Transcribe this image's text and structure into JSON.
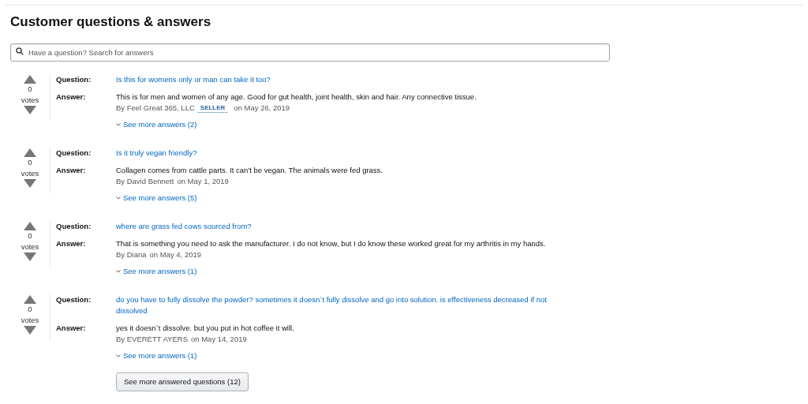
{
  "title": "Customer questions & answers",
  "search": {
    "placeholder": "Have a question? Search for answers"
  },
  "items": [
    {
      "votes": "0",
      "votes_label": "votes",
      "question_label": "Question:",
      "answer_label": "Answer:",
      "question": "Is this for womens only or man can take it too?",
      "answer": "This is for men and women of any age. Good for gut health, joint health, skin and hair. Any connective tissue.",
      "author": "By Feel Great 365, LLC",
      "badge": "SELLER",
      "date": "on May 26, 2019",
      "more": "See more answers (2)"
    },
    {
      "votes": "0",
      "votes_label": "votes",
      "question_label": "Question:",
      "answer_label": "Answer:",
      "question": "Is it truly vegan friendly?",
      "answer": "Collagen comes from cattle parts. It can't be vegan. The animals were fed grass.",
      "author": "By David Bennett",
      "date": "on May 1, 2019",
      "more": "See more answers (5)"
    },
    {
      "votes": "0",
      "votes_label": "votes",
      "question_label": "Question:",
      "answer_label": "Answer:",
      "question": "where are grass fed cows sourced from?",
      "answer": "That is something you need to ask the manufacturer. I do not know, but I do know these worked great for my arthritis in my hands.",
      "author": "By Diana",
      "date": "on May 4, 2019",
      "more": "See more answers (1)"
    },
    {
      "votes": "0",
      "votes_label": "votes",
      "question_label": "Question:",
      "answer_label": "Answer:",
      "question": "do you have to fully dissolve the powder? sometimes it doesn`t fully dissolve and go into solution. is effectiveness decreased if not dissolved",
      "answer": "yes it doesn`t dissolve. but you put in hot coffee it will.",
      "author": "By EVERETT AYERS",
      "date": "on May 14, 2019",
      "more": "See more answers (1)"
    }
  ],
  "more_button": "See more answered questions (12)"
}
